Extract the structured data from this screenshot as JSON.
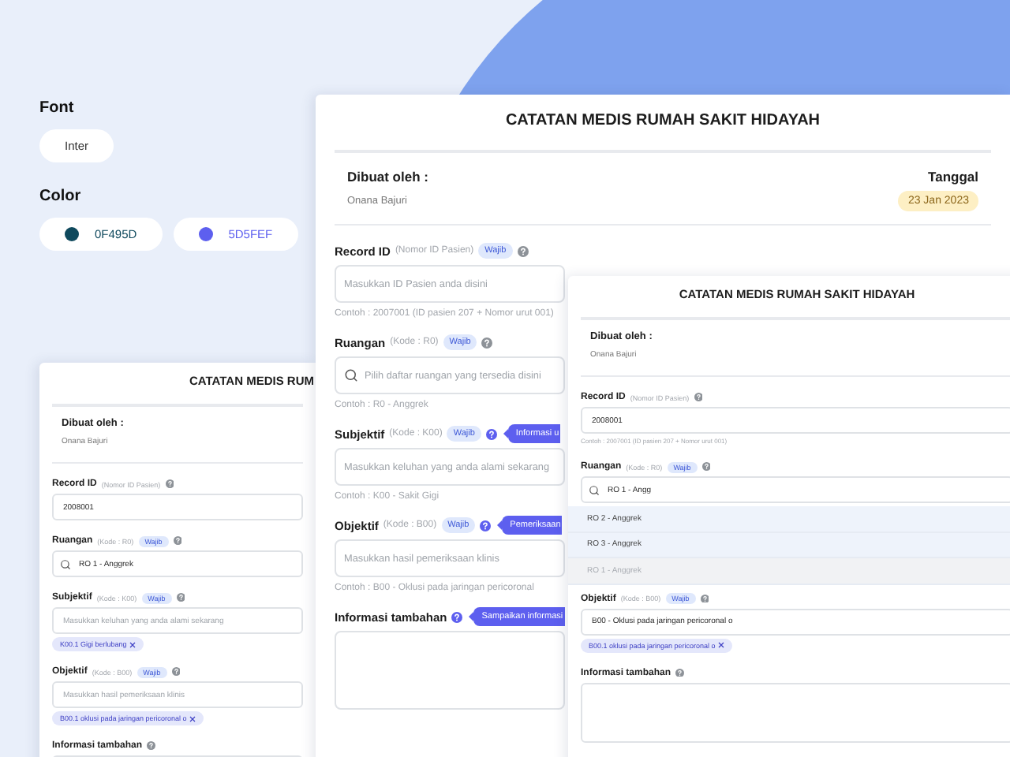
{
  "side": {
    "font_label": "Font",
    "font_value": "Inter",
    "color_label": "Color",
    "colors": [
      {
        "code": "0F495D",
        "color": "#0f495d"
      },
      {
        "code": "5D5FEF",
        "color": "#5d5fef"
      }
    ]
  },
  "cards": [
    {
      "title": "CATATAN MEDIS RUM",
      "creator_label": "Dibuat oleh :",
      "creator_name": "Onana Bajuri",
      "fields": [
        {
          "kind": "input",
          "label": "Record ID",
          "code": "(Nomor ID Pasien)",
          "value": "2008001"
        },
        {
          "kind": "search",
          "label": "Ruangan",
          "code": "(Kode : R0)",
          "badge": "Wajib",
          "value": "RO 1 - Anggrek"
        },
        {
          "kind": "input",
          "label": "Subjektif",
          "code": "(Kode : K00)",
          "badge": "Wajib",
          "placeholder": "Masukkan keluhan yang anda alami sekarang",
          "chips": [
            "K00.1 Gigi berlubang"
          ]
        },
        {
          "kind": "input",
          "label": "Objektif",
          "code": "(Kode : B00)",
          "badge": "Wajib",
          "placeholder": "Masukkan hasil pemeriksaan klinis",
          "chips": [
            "B00.1 oklusi pada jaringan pericoronal o"
          ]
        },
        {
          "kind": "textarea",
          "label": "Informasi tambahan"
        }
      ]
    },
    {
      "title": "CATATAN MEDIS RUMAH SAKIT HIDAYAH",
      "creator_label": "Dibuat oleh :",
      "creator_name": "Onana Bajuri",
      "date_label": "Tanggal",
      "date": "23 Jan 2023",
      "fields": [
        {
          "kind": "input",
          "label": "Record ID",
          "code": "(Nomor ID Pasien)",
          "badge": "Wajib",
          "placeholder": "Masukkan ID Pasien anda disini",
          "hint": "Contoh : 2007001 (ID pasien 207 + Nomor urut 001)"
        },
        {
          "kind": "search",
          "label": "Ruangan",
          "code": "(Kode : R0)",
          "badge": "Wajib",
          "placeholder": "Pilih daftar ruangan yang tersedia disini",
          "hint": "Contoh : R0 - Anggrek"
        },
        {
          "kind": "input",
          "label": "Subjektif",
          "code": "(Kode : K00)",
          "badge": "Wajib",
          "tooltip": "Informasi u",
          "placeholder": "Masukkan keluhan yang anda alami sekarang",
          "hint": "Contoh : K00 - Sakit Gigi"
        },
        {
          "kind": "input",
          "label": "Objektif",
          "code": "(Kode : B00)",
          "badge": "Wajib",
          "tooltip": "Pemeriksaan",
          "placeholder": "Masukkan hasil pemeriksaan klinis",
          "hint": "Contoh : B00 - Oklusi pada jaringan pericoronal"
        },
        {
          "kind": "textarea",
          "label": "Informasi tambahan",
          "tooltip": "Sampaikan informasi"
        }
      ]
    },
    {
      "title": "CATATAN MEDIS RUMAH SAKIT HIDAYAH",
      "creator_label": "Dibuat oleh :",
      "creator_name": "Onana Bajuri",
      "fields": [
        {
          "kind": "input",
          "label": "Record ID",
          "code": "(Nomor ID Pasien)",
          "value": "2008001",
          "hint": "Contoh : 2007001 (ID pasien 207 + Nomor urut 001)"
        },
        {
          "kind": "search",
          "label": "Ruangan",
          "code": "(Kode : R0)",
          "badge": "Wajib",
          "value": "RO 1 - Angg",
          "options": [
            {
              "text": "RO 2 - Anggrek",
              "disabled": false
            },
            {
              "text": "RO 3 - Anggrek",
              "disabled": false
            },
            {
              "text": "RO 1 - Anggrek",
              "disabled": true
            }
          ]
        },
        {
          "kind": "input",
          "label": "Objektif",
          "code": "(Kode : B00)",
          "badge": "Wajib",
          "value": "B00 - Oklusi pada jaringan pericoronal o",
          "chips": [
            "B00.1 oklusi pada jaringan pericoronal o"
          ]
        },
        {
          "kind": "textarea",
          "label": "Informasi tambahan"
        }
      ]
    }
  ]
}
